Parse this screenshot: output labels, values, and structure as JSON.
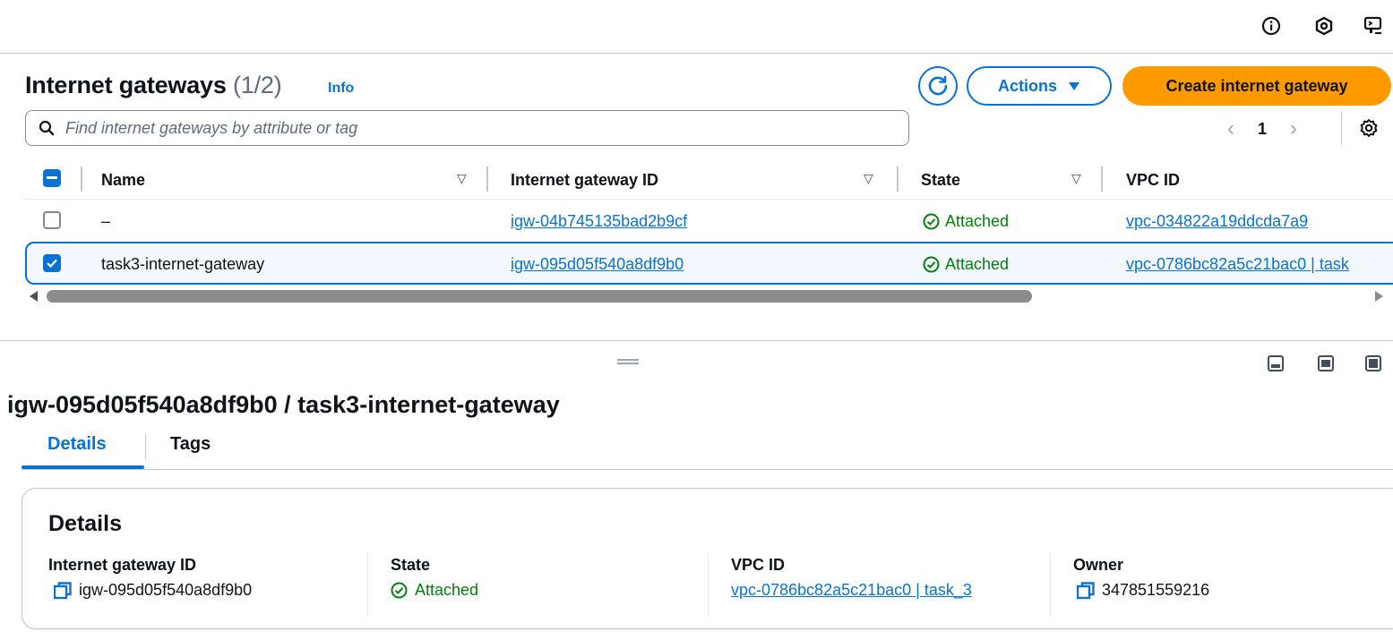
{
  "topbar": {
    "icons": [
      "info-circle-icon",
      "hexagon-icon",
      "cloudshell-icon"
    ]
  },
  "header": {
    "title": "Internet gateways",
    "count": "(1/2)",
    "info": "Info",
    "actions_label": "Actions",
    "create_label": "Create internet gateway"
  },
  "search": {
    "placeholder": "Find internet gateways by attribute or tag"
  },
  "pagination": {
    "current": "1"
  },
  "table": {
    "columns": [
      "Name",
      "Internet gateway ID",
      "State",
      "VPC ID"
    ],
    "rows": [
      {
        "name": "–",
        "id": "igw-04b745135bad2b9cf",
        "state": "Attached",
        "vpc": "vpc-034822a19ddcda7a9",
        "selected": false
      },
      {
        "name": "task3-internet-gateway",
        "id": "igw-095d05f540a8df9b0",
        "state": "Attached",
        "vpc": "vpc-0786bc82a5c21bac0 | task",
        "selected": true
      }
    ]
  },
  "detail": {
    "title": "igw-095d05f540a8df9b0 / task3-internet-gateway",
    "tabs": [
      "Details",
      "Tags"
    ],
    "card_title": "Details",
    "fields": [
      {
        "label": "Internet gateway ID",
        "value": "igw-095d05f540a8df9b0"
      },
      {
        "label": "State",
        "value": "Attached"
      },
      {
        "label": "VPC ID",
        "value": "vpc-0786bc82a5c21bac0 | task_3"
      },
      {
        "label": "Owner",
        "value": "347851559216"
      }
    ]
  },
  "colors": {
    "accent": "#0972d3",
    "primary_button": "#ff9900",
    "success": "#037f0c"
  }
}
